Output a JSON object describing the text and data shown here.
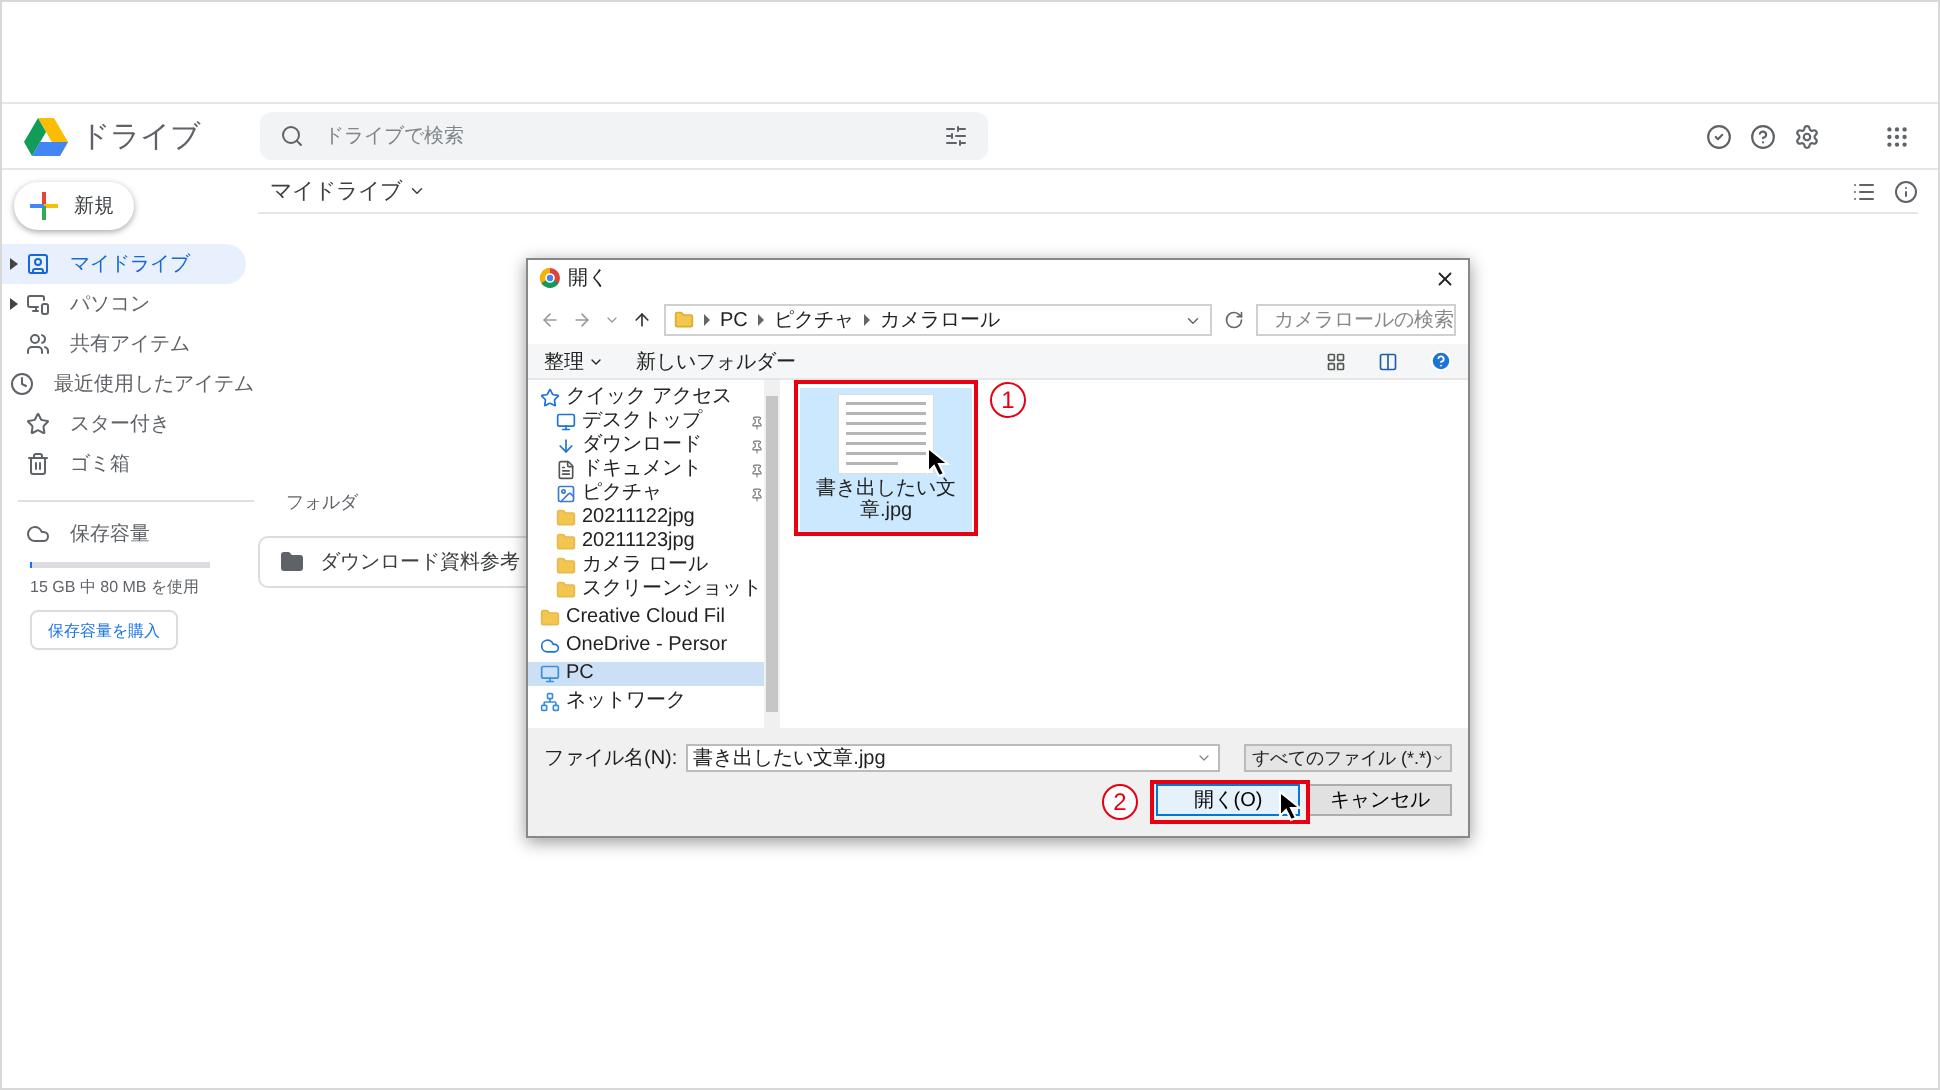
{
  "header": {
    "logo_text": "ドライブ",
    "search_placeholder": "ドライブで検索"
  },
  "new_button": "新規",
  "sidebar": {
    "items": [
      {
        "label": "マイドライブ",
        "kind": "drive",
        "expandable": true,
        "selected": true
      },
      {
        "label": "パソコン",
        "kind": "computer",
        "expandable": true,
        "selected": false
      },
      {
        "label": "共有アイテム",
        "kind": "shared",
        "expandable": false,
        "selected": false
      },
      {
        "label": "最近使用したアイテム",
        "kind": "recent",
        "expandable": false,
        "selected": false
      },
      {
        "label": "スター付き",
        "kind": "starred",
        "expandable": false,
        "selected": false
      },
      {
        "label": "ゴミ箱",
        "kind": "trash",
        "expandable": false,
        "selected": false
      }
    ],
    "storage": {
      "label": "保存容量",
      "level": 0.005,
      "usage": "15 GB 中 80 MB を使用",
      "buy_button": "保存容量を購入"
    }
  },
  "main": {
    "title": "マイドライブ",
    "section_label": "フォルダ",
    "folders": [
      "ダウンロード資料参考"
    ]
  },
  "dialog": {
    "title": "開く",
    "path": [
      "PC",
      "ピクチャ",
      "カメラロール"
    ],
    "search_placeholder": "カメラロールの検索",
    "organize": "整理",
    "new_folder": "新しいフォルダー",
    "nav": [
      {
        "label": "クイック アクセス",
        "kind": "star",
        "selected": false,
        "children": [
          {
            "label": "デスクトップ",
            "kind": "desktop",
            "pinned": true,
            "selected": false
          },
          {
            "label": "ダウンロード",
            "kind": "download",
            "pinned": true,
            "selected": false
          },
          {
            "label": "ドキュメント",
            "kind": "document",
            "pinned": true,
            "selected": false
          },
          {
            "label": "ピクチャ",
            "kind": "pictures",
            "pinned": true,
            "selected": false
          },
          {
            "label": "20211122jpg",
            "kind": "folder",
            "pinned": false,
            "selected": false
          },
          {
            "label": "20211123jpg",
            "kind": "folder",
            "pinned": false,
            "selected": false
          },
          {
            "label": "カメラ ロール",
            "kind": "folder",
            "pinned": false,
            "selected": false
          },
          {
            "label": "スクリーンショット",
            "kind": "folder",
            "pinned": false,
            "selected": false
          }
        ]
      },
      {
        "label": "Creative Cloud Fil",
        "kind": "ccfolder",
        "selected": false
      },
      {
        "label": "OneDrive - Persor",
        "kind": "cloud",
        "selected": false
      },
      {
        "label": "PC",
        "kind": "pc",
        "selected": true
      },
      {
        "label": "ネットワーク",
        "kind": "network",
        "selected": false
      }
    ],
    "files": [
      {
        "name": "書き出したい文章.jpg",
        "selected": true
      }
    ],
    "filename_label": "ファイル名(N):",
    "filename_value": "書き出したい文章.jpg",
    "filter": "すべてのファイル (*.*)",
    "open_button": "開く(O)",
    "cancel_button": "キャンセル"
  },
  "annotations": [
    "1",
    "2"
  ]
}
